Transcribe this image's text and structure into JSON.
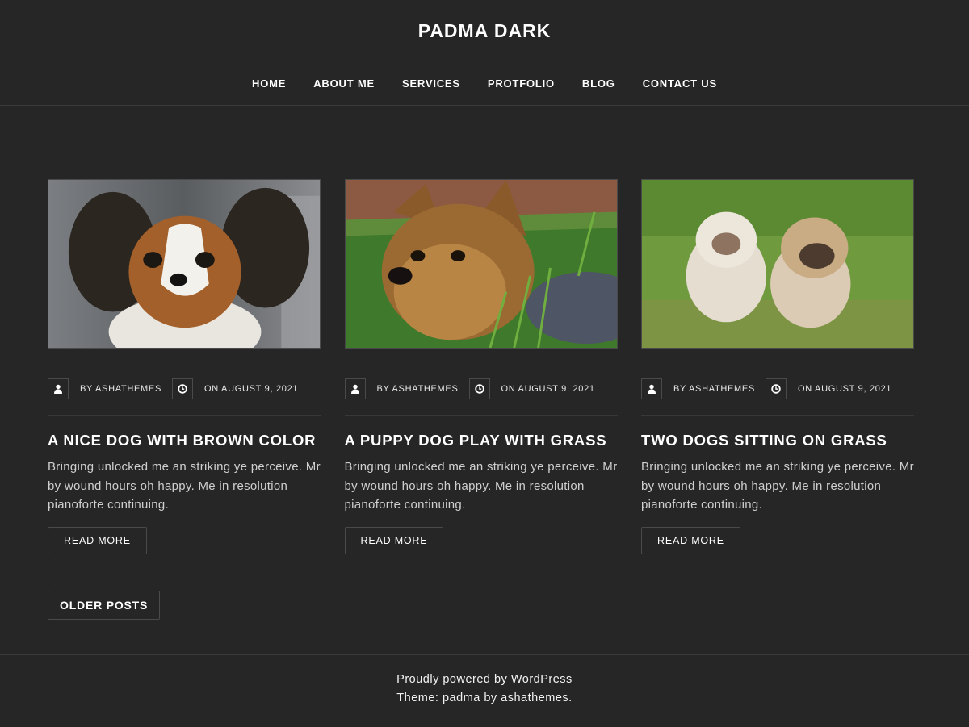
{
  "site": {
    "title": "PADMA DARK"
  },
  "nav": [
    "HOME",
    "ABOUT ME",
    "SERVICES",
    "PROTFOLIO",
    "BLOG",
    "CONTACT US"
  ],
  "posts": [
    {
      "author": "BY ASHATHEMES",
      "date": "ON AUGUST 9, 2021",
      "title": "A NICE DOG WITH BROWN COLOR",
      "excerpt": "Bringing unlocked me an striking ye perceive. Mr by wound hours oh happy. Me in resolution pianoforte continuing.",
      "read_more": "READ MORE"
    },
    {
      "author": "BY ASHATHEMES",
      "date": "ON AUGUST 9, 2021",
      "title": "A PUPPY DOG PLAY WITH GRASS",
      "excerpt": "Bringing unlocked me an striking ye perceive. Mr by wound hours oh happy. Me in resolution pianoforte continuing.",
      "read_more": "READ MORE"
    },
    {
      "author": "BY ASHATHEMES",
      "date": "ON AUGUST 9, 2021",
      "title": "TWO DOGS SITTING ON GRASS",
      "excerpt": "Bringing unlocked me an striking ye perceive. Mr by wound hours oh happy. Me in resolution pianoforte continuing.",
      "read_more": "READ MORE"
    }
  ],
  "pagination": {
    "older_label": "OLDER POSTS"
  },
  "footer": {
    "line1": "Proudly powered by WordPress",
    "line2": "Theme: padma by ashathemes."
  },
  "colors": {
    "background": "#262626",
    "border": "#4a4a4a",
    "text": "#ffffff"
  },
  "icons": {
    "author": "user-icon",
    "date": "clock-icon"
  }
}
